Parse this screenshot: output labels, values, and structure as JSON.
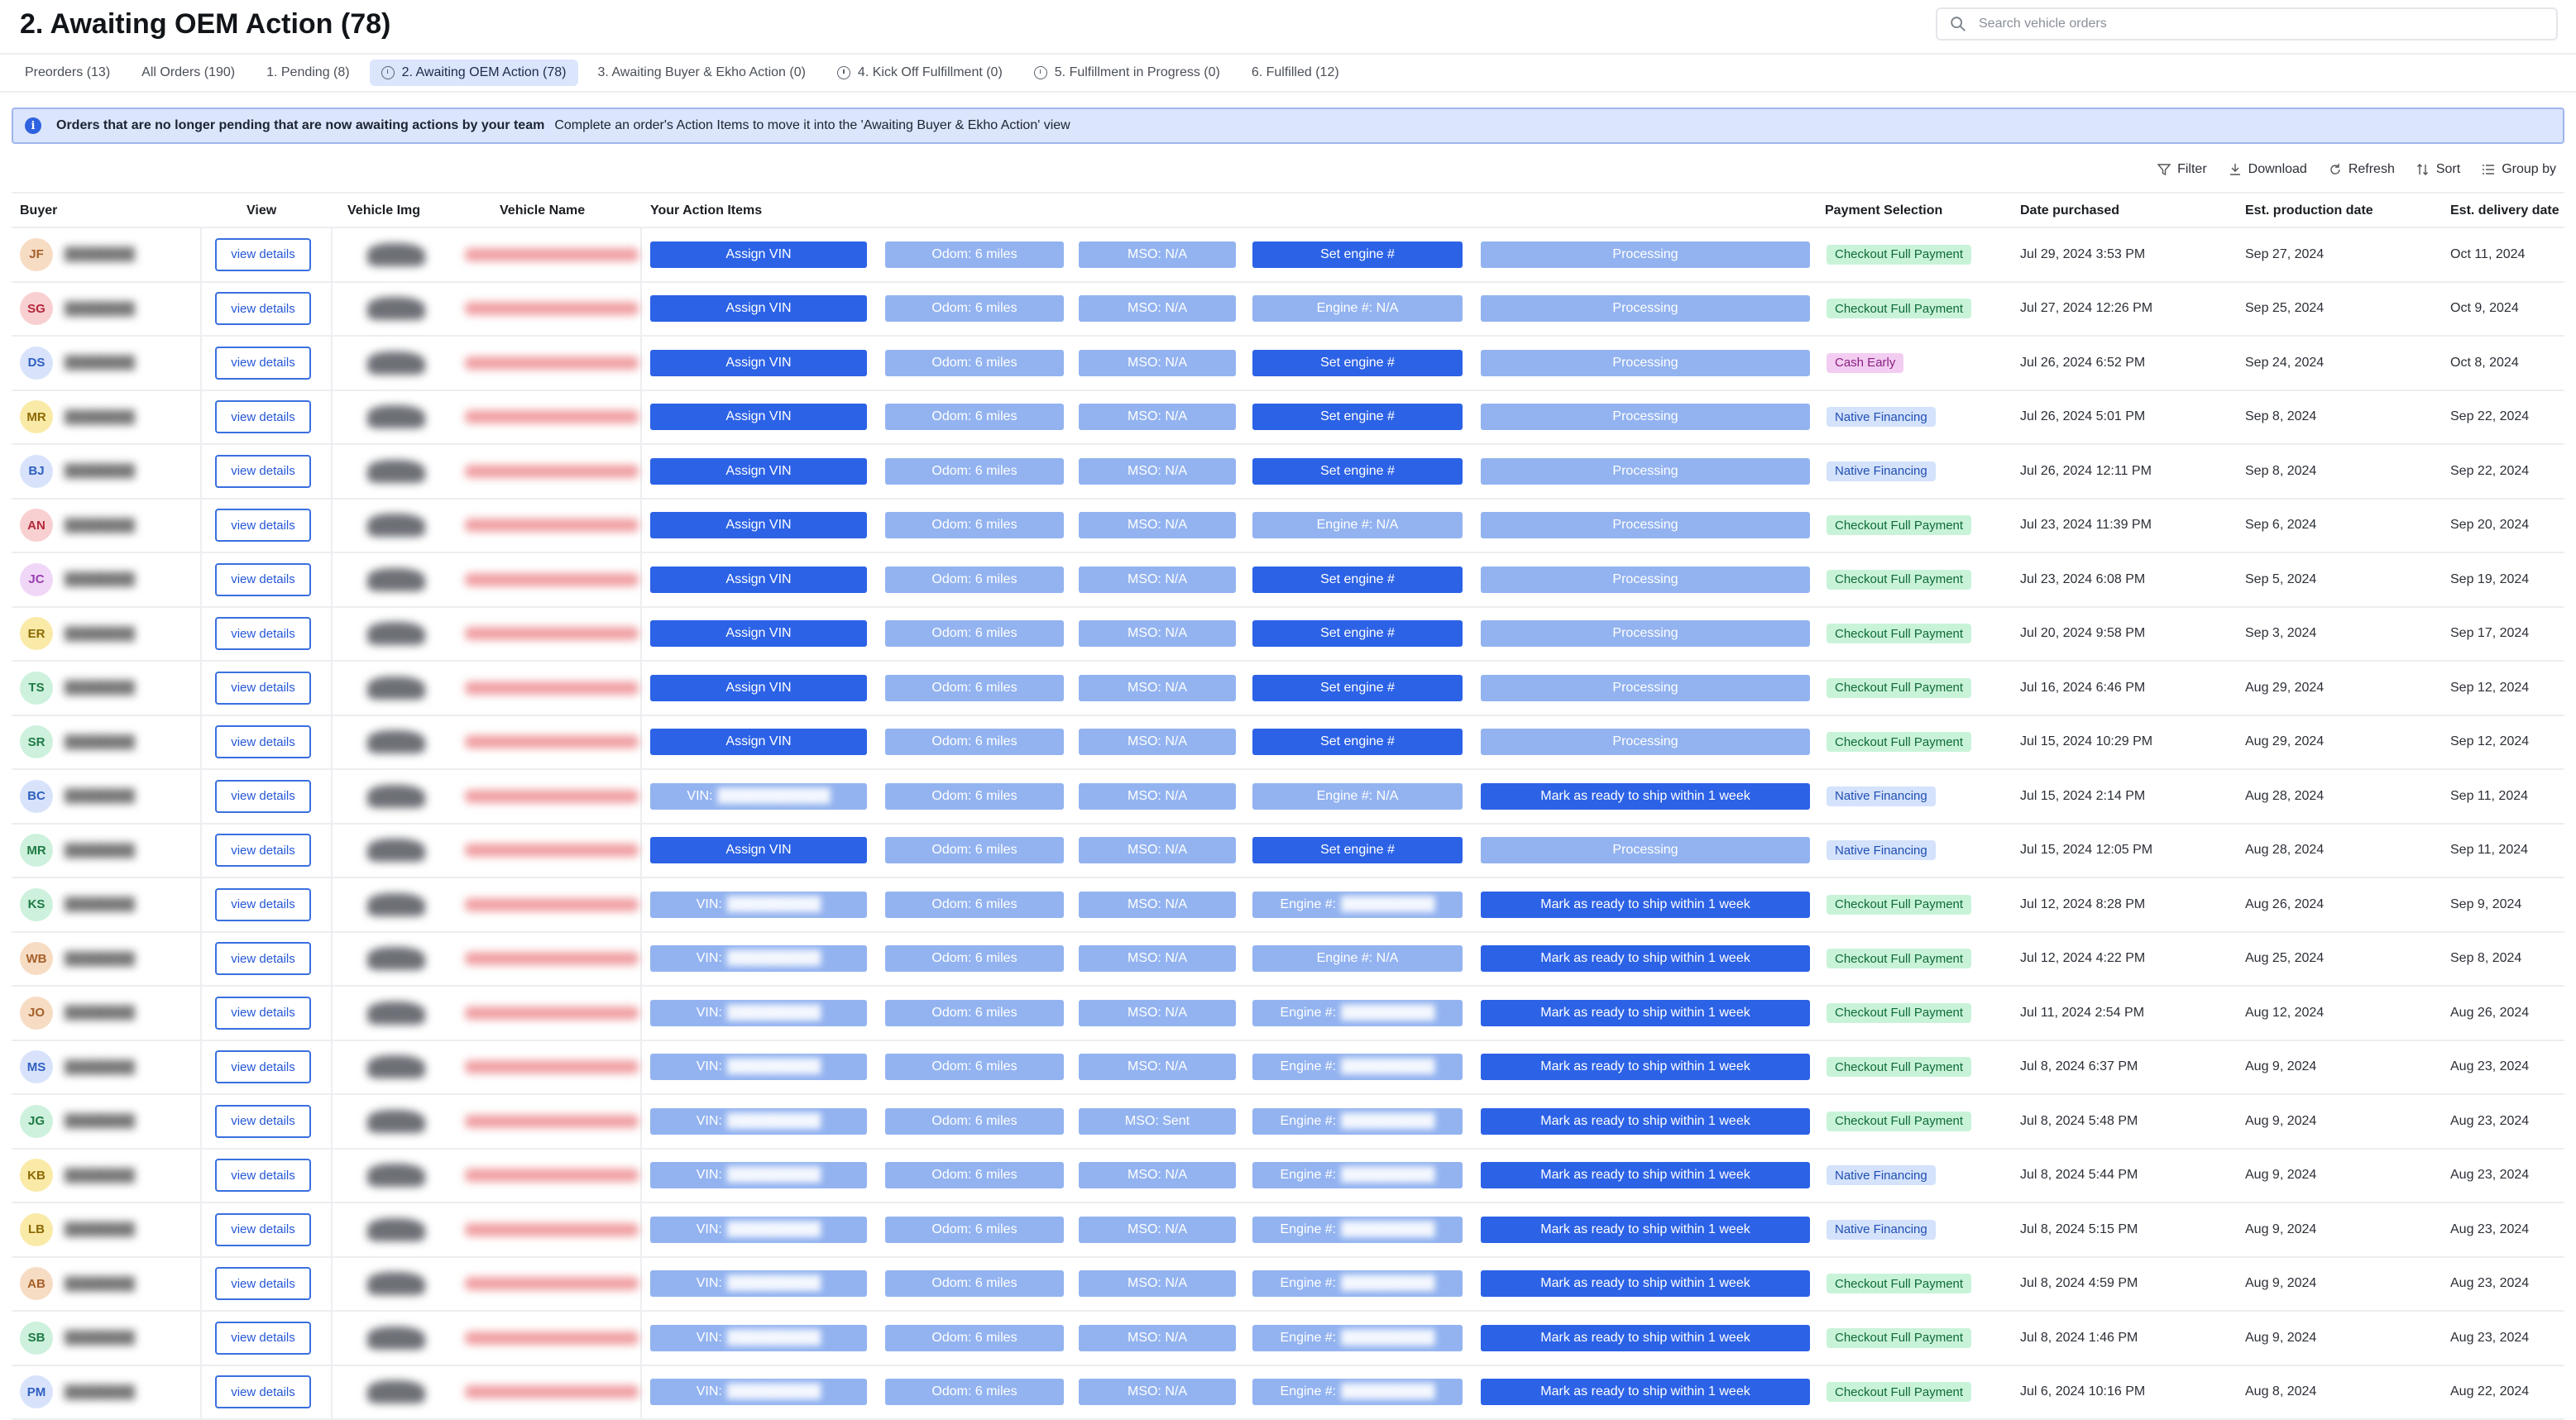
{
  "header": {
    "title": "2. Awaiting OEM Action (78)"
  },
  "search": {
    "placeholder": "Search vehicle orders"
  },
  "tabs": [
    {
      "label": "Preorders (13)",
      "icon": "",
      "active": false
    },
    {
      "label": "All Orders (190)",
      "icon": "",
      "active": false
    },
    {
      "label": "1. Pending (8)",
      "icon": "",
      "active": false
    },
    {
      "label": "2. Awaiting OEM Action (78)",
      "icon": "info-circle-icon",
      "active": true
    },
    {
      "label": "3. Awaiting Buyer & Ekho Action (0)",
      "icon": "",
      "active": false
    },
    {
      "label": "4. Kick Off Fulfillment (0)",
      "icon": "info-circle-icon",
      "active": false
    },
    {
      "label": "5. Fulfillment in Progress (0)",
      "icon": "info-circle-icon",
      "active": false
    },
    {
      "label": "6. Fulfilled (12)",
      "icon": "",
      "active": false
    }
  ],
  "banner": {
    "title": "Orders that are no longer pending that are now awaiting actions by your team",
    "text": "Complete an order's Action Items to move it into the 'Awaiting Buyer & Ekho Action' view"
  },
  "toolbar": {
    "filter": "Filter",
    "download": "Download",
    "refresh": "Refresh",
    "sort": "Sort",
    "group_by": "Group by"
  },
  "columns": {
    "buyer": "Buyer",
    "view": "View",
    "vehicle_img": "Vehicle Img",
    "vehicle_name": "Vehicle Name",
    "action_items": "Your Action Items",
    "payment": "Payment Selection",
    "date_purchased": "Date purchased",
    "production": "Est. production date",
    "delivery": "Est. delivery date"
  },
  "colors": {
    "accent": "#2c62e6",
    "accent_light": "#93b3f0",
    "banner_bg": "#dbe5fb"
  },
  "rows": [
    {
      "initials": "JF",
      "avatar_color": "#f7dcc4",
      "avatar_text": "#a4602a",
      "view": "view details",
      "vin": "Assign VIN",
      "vin_style": "dark",
      "vin_blur": "",
      "odom": "Odom: 6 miles",
      "mso": "MSO: N/A",
      "engine": "Set engine #",
      "engine_style": "dark",
      "engine_blur": "",
      "status": "Processing",
      "status_style": "light",
      "payment": "Checkout Full Payment",
      "payment_style": "green",
      "purchased": "Jul 29, 2024 3:53 PM",
      "production": "Sep 27, 2024",
      "delivery": "Oct 11, 2024"
    },
    {
      "initials": "SG",
      "avatar_color": "#f9d0d2",
      "avatar_text": "#b3283a",
      "view": "view details",
      "vin": "Assign VIN",
      "vin_style": "dark",
      "vin_blur": "",
      "odom": "Odom: 6 miles",
      "mso": "MSO: N/A",
      "engine": "Engine #: N/A",
      "engine_style": "light",
      "engine_blur": "",
      "status": "Processing",
      "status_style": "light",
      "payment": "Checkout Full Payment",
      "payment_style": "green",
      "purchased": "Jul 27, 2024 12:26 PM",
      "production": "Sep 25, 2024",
      "delivery": "Oct 9, 2024"
    },
    {
      "initials": "DS",
      "avatar_color": "#d8e3fb",
      "avatar_text": "#2f5fc0",
      "view": "view details",
      "vin": "Assign VIN",
      "vin_style": "dark",
      "vin_blur": "",
      "odom": "Odom: 6 miles",
      "mso": "MSO: N/A",
      "engine": "Set engine #",
      "engine_style": "dark",
      "engine_blur": "",
      "status": "Processing",
      "status_style": "light",
      "payment": "Cash Early",
      "payment_style": "purple",
      "purchased": "Jul 26, 2024 6:52 PM",
      "production": "Sep 24, 2024",
      "delivery": "Oct 8, 2024"
    },
    {
      "initials": "MR",
      "avatar_color": "#faeaa8",
      "avatar_text": "#8b6a05",
      "view": "view details",
      "vin": "Assign VIN",
      "vin_style": "dark",
      "vin_blur": "",
      "odom": "Odom: 6 miles",
      "mso": "MSO: N/A",
      "engine": "Set engine #",
      "engine_style": "dark",
      "engine_blur": "",
      "status": "Processing",
      "status_style": "light",
      "payment": "Native Financing",
      "payment_style": "blue",
      "purchased": "Jul 26, 2024 5:01 PM",
      "production": "Sep 8, 2024",
      "delivery": "Sep 22, 2024"
    },
    {
      "initials": "BJ",
      "avatar_color": "#d8e3fb",
      "avatar_text": "#2f5fc0",
      "view": "view details",
      "vin": "Assign VIN",
      "vin_style": "dark",
      "vin_blur": "",
      "odom": "Odom: 6 miles",
      "mso": "MSO: N/A",
      "engine": "Set engine #",
      "engine_style": "dark",
      "engine_blur": "",
      "status": "Processing",
      "status_style": "light",
      "payment": "Native Financing",
      "payment_style": "blue",
      "purchased": "Jul 26, 2024 12:11 PM",
      "production": "Sep 8, 2024",
      "delivery": "Sep 22, 2024"
    },
    {
      "initials": "AN",
      "avatar_color": "#f9d0d2",
      "avatar_text": "#b3283a",
      "view": "view details",
      "vin": "Assign VIN",
      "vin_style": "dark",
      "vin_blur": "",
      "odom": "Odom: 6 miles",
      "mso": "MSO: N/A",
      "engine": "Engine #: N/A",
      "engine_style": "light",
      "engine_blur": "",
      "status": "Processing",
      "status_style": "light",
      "payment": "Checkout Full Payment",
      "payment_style": "green",
      "purchased": "Jul 23, 2024 11:39 PM",
      "production": "Sep 6, 2024",
      "delivery": "Sep 20, 2024"
    },
    {
      "initials": "JC",
      "avatar_color": "#f1d7f7",
      "avatar_text": "#9a3db3",
      "view": "view details",
      "vin": "Assign VIN",
      "vin_style": "dark",
      "vin_blur": "",
      "odom": "Odom: 6 miles",
      "mso": "MSO: N/A",
      "engine": "Set engine #",
      "engine_style": "dark",
      "engine_blur": "",
      "status": "Processing",
      "status_style": "light",
      "payment": "Checkout Full Payment",
      "payment_style": "green",
      "purchased": "Jul 23, 2024 6:08 PM",
      "production": "Sep 5, 2024",
      "delivery": "Sep 19, 2024"
    },
    {
      "initials": "ER",
      "avatar_color": "#faeaa8",
      "avatar_text": "#8b6a05",
      "view": "view details",
      "vin": "Assign VIN",
      "vin_style": "dark",
      "vin_blur": "",
      "odom": "Odom: 6 miles",
      "mso": "MSO: N/A",
      "engine": "Set engine #",
      "engine_style": "dark",
      "engine_blur": "",
      "status": "Processing",
      "status_style": "light",
      "payment": "Checkout Full Payment",
      "payment_style": "green",
      "purchased": "Jul 20, 2024 9:58 PM",
      "production": "Sep 3, 2024",
      "delivery": "Sep 17, 2024"
    },
    {
      "initials": "TS",
      "avatar_color": "#cdf1dc",
      "avatar_text": "#1f7a45",
      "view": "view details",
      "vin": "Assign VIN",
      "vin_style": "dark",
      "vin_blur": "",
      "odom": "Odom: 6 miles",
      "mso": "MSO: N/A",
      "engine": "Set engine #",
      "engine_style": "dark",
      "engine_blur": "",
      "status": "Processing",
      "status_style": "light",
      "payment": "Checkout Full Payment",
      "payment_style": "green",
      "purchased": "Jul 16, 2024 6:46 PM",
      "production": "Aug 29, 2024",
      "delivery": "Sep 12, 2024"
    },
    {
      "initials": "SR",
      "avatar_color": "#cdf1dc",
      "avatar_text": "#1f7a45",
      "view": "view details",
      "vin": "Assign VIN",
      "vin_style": "dark",
      "vin_blur": "",
      "odom": "Odom: 6 miles",
      "mso": "MSO: N/A",
      "engine": "Set engine #",
      "engine_style": "dark",
      "engine_blur": "",
      "status": "Processing",
      "status_style": "light",
      "payment": "Checkout Full Payment",
      "payment_style": "green",
      "purchased": "Jul 15, 2024 10:29 PM",
      "production": "Aug 29, 2024",
      "delivery": "Sep 12, 2024"
    },
    {
      "initials": "BC",
      "avatar_color": "#d8e3fb",
      "avatar_text": "#2f5fc0",
      "view": "view details",
      "vin": "VIN:",
      "vin_style": "light",
      "vin_blur": "████████████",
      "odom": "Odom: 6 miles",
      "mso": "MSO: N/A",
      "engine": "Engine #: N/A",
      "engine_style": "light",
      "engine_blur": "",
      "status": "Mark as ready to ship within 1 week",
      "status_style": "dark",
      "payment": "Native Financing",
      "payment_style": "blue",
      "purchased": "Jul 15, 2024 2:14 PM",
      "production": "Aug 28, 2024",
      "delivery": "Sep 11, 2024"
    },
    {
      "initials": "MR",
      "avatar_color": "#cdf1dc",
      "avatar_text": "#1f7a45",
      "view": "view details",
      "vin": "Assign VIN",
      "vin_style": "dark",
      "vin_blur": "",
      "odom": "Odom: 6 miles",
      "mso": "MSO: N/A",
      "engine": "Set engine #",
      "engine_style": "dark",
      "engine_blur": "",
      "status": "Processing",
      "status_style": "light",
      "payment": "Native Financing",
      "payment_style": "blue",
      "purchased": "Jul 15, 2024 12:05 PM",
      "production": "Aug 28, 2024",
      "delivery": "Sep 11, 2024"
    },
    {
      "initials": "KS",
      "avatar_color": "#cdf1dc",
      "avatar_text": "#1f7a45",
      "view": "view details",
      "vin": "VIN:",
      "vin_style": "light",
      "vin_blur": "██████████",
      "odom": "Odom: 6 miles",
      "mso": "MSO: N/A",
      "engine": "Engine #:",
      "engine_style": "light",
      "engine_blur": "██████████",
      "status": "Mark as ready to ship within 1 week",
      "status_style": "dark",
      "payment": "Checkout Full Payment",
      "payment_style": "green",
      "purchased": "Jul 12, 2024 8:28 PM",
      "production": "Aug 26, 2024",
      "delivery": "Sep 9, 2024"
    },
    {
      "initials": "WB",
      "avatar_color": "#f7dcc4",
      "avatar_text": "#a4602a",
      "view": "view details",
      "vin": "VIN:",
      "vin_style": "light",
      "vin_blur": "██████████",
      "odom": "Odom: 6 miles",
      "mso": "MSO: N/A",
      "engine": "Engine #: N/A",
      "engine_style": "light",
      "engine_blur": "",
      "status": "Mark as ready to ship within 1 week",
      "status_style": "dark",
      "payment": "Checkout Full Payment",
      "payment_style": "green",
      "purchased": "Jul 12, 2024 4:22 PM",
      "production": "Aug 25, 2024",
      "delivery": "Sep 8, 2024"
    },
    {
      "initials": "JO",
      "avatar_color": "#f7dcc4",
      "avatar_text": "#a4602a",
      "view": "view details",
      "vin": "VIN:",
      "vin_style": "light",
      "vin_blur": "██████████",
      "odom": "Odom: 6 miles",
      "mso": "MSO: N/A",
      "engine": "Engine #:",
      "engine_style": "light",
      "engine_blur": "██████████",
      "status": "Mark as ready to ship within 1 week",
      "status_style": "dark",
      "payment": "Checkout Full Payment",
      "payment_style": "green",
      "purchased": "Jul 11, 2024 2:54 PM",
      "production": "Aug 12, 2024",
      "delivery": "Aug 26, 2024"
    },
    {
      "initials": "MS",
      "avatar_color": "#d8e3fb",
      "avatar_text": "#2f5fc0",
      "view": "view details",
      "vin": "VIN:",
      "vin_style": "light",
      "vin_blur": "██████████",
      "odom": "Odom: 6 miles",
      "mso": "MSO: N/A",
      "engine": "Engine #:",
      "engine_style": "light",
      "engine_blur": "██████████",
      "status": "Mark as ready to ship within 1 week",
      "status_style": "dark",
      "payment": "Checkout Full Payment",
      "payment_style": "green",
      "purchased": "Jul 8, 2024 6:37 PM",
      "production": "Aug 9, 2024",
      "delivery": "Aug 23, 2024"
    },
    {
      "initials": "JG",
      "avatar_color": "#cdf1dc",
      "avatar_text": "#1f7a45",
      "view": "view details",
      "vin": "VIN:",
      "vin_style": "light",
      "vin_blur": "██████████",
      "odom": "Odom: 6 miles",
      "mso": "MSO: Sent",
      "engine": "Engine #:",
      "engine_style": "light",
      "engine_blur": "██████████",
      "status": "Mark as ready to ship within 1 week",
      "status_style": "dark",
      "payment": "Checkout Full Payment",
      "payment_style": "green",
      "purchased": "Jul 8, 2024 5:48 PM",
      "production": "Aug 9, 2024",
      "delivery": "Aug 23, 2024"
    },
    {
      "initials": "KB",
      "avatar_color": "#faeaa8",
      "avatar_text": "#8b6a05",
      "view": "view details",
      "vin": "VIN:",
      "vin_style": "light",
      "vin_blur": "██████████",
      "odom": "Odom: 6 miles",
      "mso": "MSO: N/A",
      "engine": "Engine #:",
      "engine_style": "light",
      "engine_blur": "██████████",
      "status": "Mark as ready to ship within 1 week",
      "status_style": "dark",
      "payment": "Native Financing",
      "payment_style": "blue",
      "purchased": "Jul 8, 2024 5:44 PM",
      "production": "Aug 9, 2024",
      "delivery": "Aug 23, 2024"
    },
    {
      "initials": "LB",
      "avatar_color": "#faeaa8",
      "avatar_text": "#8b6a05",
      "view": "view details",
      "vin": "VIN:",
      "vin_style": "light",
      "vin_blur": "██████████",
      "odom": "Odom: 6 miles",
      "mso": "MSO: N/A",
      "engine": "Engine #:",
      "engine_style": "light",
      "engine_blur": "██████████",
      "status": "Mark as ready to ship within 1 week",
      "status_style": "dark",
      "payment": "Native Financing",
      "payment_style": "blue",
      "purchased": "Jul 8, 2024 5:15 PM",
      "production": "Aug 9, 2024",
      "delivery": "Aug 23, 2024"
    },
    {
      "initials": "AB",
      "avatar_color": "#f7dcc4",
      "avatar_text": "#a4602a",
      "view": "view details",
      "vin": "VIN:",
      "vin_style": "light",
      "vin_blur": "██████████",
      "odom": "Odom: 6 miles",
      "mso": "MSO: N/A",
      "engine": "Engine #:",
      "engine_style": "light",
      "engine_blur": "██████████",
      "status": "Mark as ready to ship within 1 week",
      "status_style": "dark",
      "payment": "Checkout Full Payment",
      "payment_style": "green",
      "purchased": "Jul 8, 2024 4:59 PM",
      "production": "Aug 9, 2024",
      "delivery": "Aug 23, 2024"
    },
    {
      "initials": "SB",
      "avatar_color": "#cdf1dc",
      "avatar_text": "#1f7a45",
      "view": "view details",
      "vin": "VIN:",
      "vin_style": "light",
      "vin_blur": "██████████",
      "odom": "Odom: 6 miles",
      "mso": "MSO: N/A",
      "engine": "Engine #:",
      "engine_style": "light",
      "engine_blur": "██████████",
      "status": "Mark as ready to ship within 1 week",
      "status_style": "dark",
      "payment": "Checkout Full Payment",
      "payment_style": "green",
      "purchased": "Jul 8, 2024 1:46 PM",
      "production": "Aug 9, 2024",
      "delivery": "Aug 23, 2024"
    },
    {
      "initials": "PM",
      "avatar_color": "#d8e3fb",
      "avatar_text": "#2f5fc0",
      "view": "view details",
      "vin": "VIN:",
      "vin_style": "light",
      "vin_blur": "██████████",
      "odom": "Odom: 6 miles",
      "mso": "MSO: N/A",
      "engine": "Engine #:",
      "engine_style": "light",
      "engine_blur": "██████████",
      "status": "Mark as ready to ship within 1 week",
      "status_style": "dark",
      "payment": "Checkout Full Payment",
      "payment_style": "green",
      "purchased": "Jul 6, 2024 10:16 PM",
      "production": "Aug 8, 2024",
      "delivery": "Aug 22, 2024"
    }
  ]
}
